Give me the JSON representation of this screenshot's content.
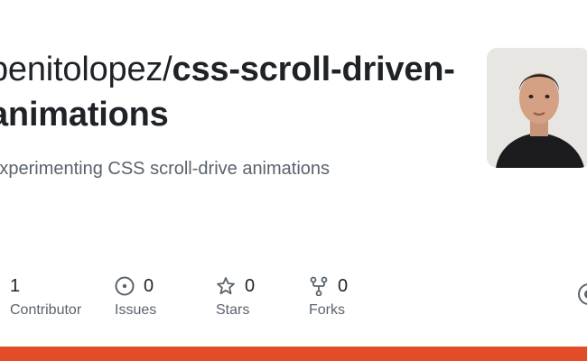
{
  "repo": {
    "owner": "benitolopez/",
    "name": "css-scroll-driven-animations",
    "description": "Experimenting CSS scroll-drive animations"
  },
  "stats": [
    {
      "value": "1",
      "label": "Contributor",
      "icon": "people-icon"
    },
    {
      "value": "0",
      "label": "Issues",
      "icon": "issue-icon"
    },
    {
      "value": "0",
      "label": "Stars",
      "icon": "star-icon"
    },
    {
      "value": "0",
      "label": "Forks",
      "icon": "fork-icon"
    }
  ],
  "colors": {
    "language_bar": "#e34c26",
    "text": "#1f2328",
    "muted": "#59636e"
  }
}
